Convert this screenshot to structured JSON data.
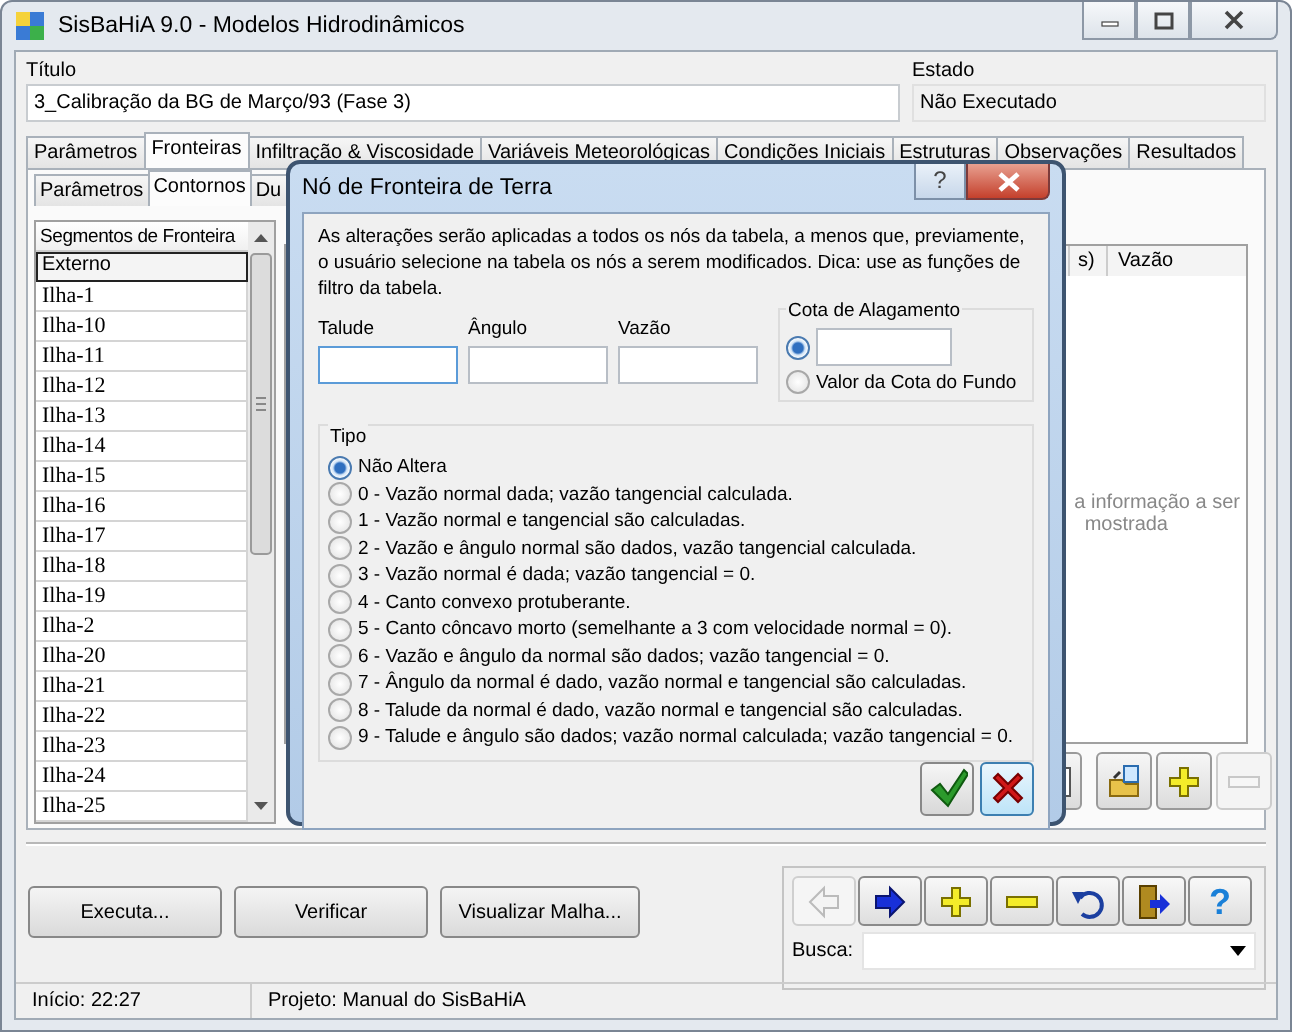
{
  "window": {
    "title": "SisBaHiA 9.0 - Modelos Hidrodinâmicos"
  },
  "header": {
    "title_label": "Título",
    "title_value": "3_Calibração da BG de Março/93 (Fase 3)",
    "state_label": "Estado",
    "state_value": "Não Executado"
  },
  "tabs": [
    {
      "label": "Parâmetros",
      "selected": false
    },
    {
      "label": "Fronteiras",
      "selected": true
    },
    {
      "label": "Infiltração & Viscosidade",
      "selected": false
    },
    {
      "label": "Variáveis Meteorológicas",
      "selected": false
    },
    {
      "label": "Condições Iniciais",
      "selected": false
    },
    {
      "label": "Estruturas",
      "selected": false
    },
    {
      "label": "Observações",
      "selected": false
    },
    {
      "label": "Resultados",
      "selected": false
    }
  ],
  "subtabs": [
    {
      "label": "Parâmetros",
      "selected": false
    },
    {
      "label": "Contornos",
      "selected": true
    },
    {
      "label": "Du",
      "selected": false
    }
  ],
  "segments": {
    "header": "Segmentos de Fronteira",
    "items": [
      {
        "label": "Externo",
        "selected": true
      },
      {
        "label": "Ilha-1",
        "selected": false
      },
      {
        "label": "Ilha-10",
        "selected": false
      },
      {
        "label": "Ilha-11",
        "selected": false
      },
      {
        "label": "Ilha-12",
        "selected": false
      },
      {
        "label": "Ilha-13",
        "selected": false
      },
      {
        "label": "Ilha-14",
        "selected": false
      },
      {
        "label": "Ilha-15",
        "selected": false
      },
      {
        "label": "Ilha-16",
        "selected": false
      },
      {
        "label": "Ilha-17",
        "selected": false
      },
      {
        "label": "Ilha-18",
        "selected": false
      },
      {
        "label": "Ilha-19",
        "selected": false
      },
      {
        "label": "Ilha-2",
        "selected": false
      },
      {
        "label": "Ilha-20",
        "selected": false
      },
      {
        "label": "Ilha-21",
        "selected": false
      },
      {
        "label": "Ilha-22",
        "selected": false
      },
      {
        "label": "Ilha-23",
        "selected": false
      },
      {
        "label": "Ilha-24",
        "selected": false
      },
      {
        "label": "Ilha-25",
        "selected": false
      }
    ]
  },
  "node_table": {
    "columns": [
      "s)",
      "Vazão"
    ],
    "empty_message": [
      "a informação a ser",
      "mostrada"
    ]
  },
  "table_toolbar": [
    {
      "kind": "copy",
      "disabled": false
    },
    {
      "kind": "open",
      "disabled": false
    },
    {
      "kind": "add",
      "disabled": false
    },
    {
      "kind": "remove",
      "disabled": true
    }
  ],
  "actions": [
    "Executa...",
    "Verificar",
    "Visualizar Malha..."
  ],
  "navigator": {
    "buttons": [
      {
        "kind": "back",
        "disabled": true
      },
      {
        "kind": "forward",
        "disabled": false
      },
      {
        "kind": "add",
        "disabled": false
      },
      {
        "kind": "remove",
        "disabled": false
      },
      {
        "kind": "undo",
        "disabled": false
      },
      {
        "kind": "exit",
        "disabled": false
      },
      {
        "kind": "help",
        "disabled": false,
        "label": "?"
      }
    ],
    "search_label": "Busca:"
  },
  "status_bar": [
    "Início: 22:27",
    "Projeto: Manual do SisBaHiA"
  ],
  "dialog": {
    "title": "Nó de Fronteira de Terra",
    "help_label": "?",
    "message": "As alterações serão aplicadas a todos os nós da tabela, a menos que, previamente, o usuário selecione na tabela os nós a serem modificados. Dica: use as funções de filtro da tabela.",
    "fields": [
      {
        "label": "Talude",
        "focused": true
      },
      {
        "label": "Ângulo",
        "focused": false
      },
      {
        "label": "Vazão",
        "focused": false
      }
    ],
    "flood": {
      "title": "Cota de Alagamento",
      "options": [
        {
          "kind": "value",
          "selected": true
        },
        {
          "kind": "bottom",
          "label": "Valor da Cota do Fundo",
          "selected": false
        }
      ]
    },
    "type_group": {
      "title": "Tipo",
      "options": [
        {
          "label": "Não Altera",
          "selected": true
        },
        {
          "label": "0 - Vazão normal dada; vazão tangencial calculada.",
          "selected": false
        },
        {
          "label": "1 - Vazão normal e tangencial são calculadas.",
          "selected": false
        },
        {
          "label": "2 - Vazão e ângulo normal são dados, vazão tangencial calculada.",
          "selected": false
        },
        {
          "label": "3 - Vazão normal é dada; vazão tangencial = 0.",
          "selected": false
        },
        {
          "label": "4 - Canto convexo protuberante.",
          "selected": false
        },
        {
          "label": "5 - Canto côncavo morto (semelhante a 3 com velocidade normal = 0).",
          "selected": false
        },
        {
          "label": "6 - Vazão e ângulo da normal são dados; vazão tangencial = 0.",
          "selected": false
        },
        {
          "label": "7 - Ângulo da normal é dado, vazão normal e tangencial são calculadas.",
          "selected": false
        },
        {
          "label": "8 - Talude da normal é dado, vazão normal e tangencial são calculadas.",
          "selected": false
        },
        {
          "label": "9 - Talude e ângulo são dados; vazão normal calculada; vazão tangencial = 0.",
          "selected": false
        }
      ]
    },
    "buttons": [
      {
        "kind": "ok"
      },
      {
        "kind": "cancel"
      }
    ]
  }
}
